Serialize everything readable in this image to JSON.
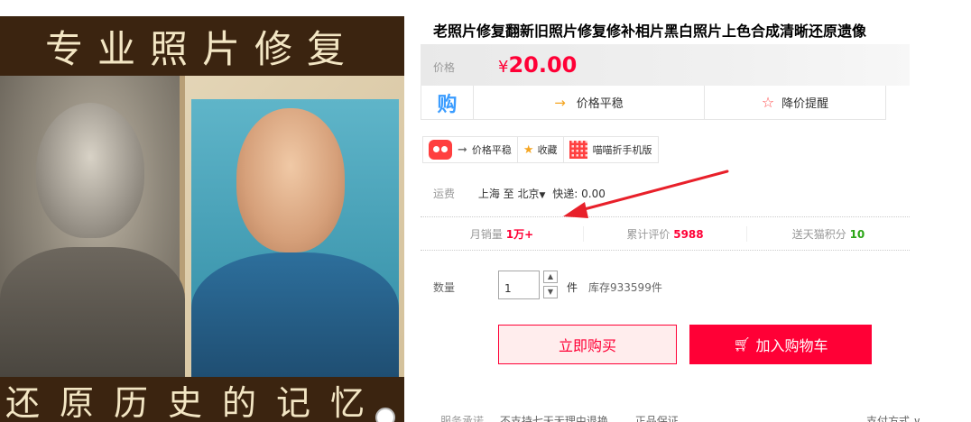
{
  "image": {
    "top_banner": "专业照片修复",
    "bottom_banner": "还原历史的记忆"
  },
  "title": "老照片修复翻新旧照片修复修补相片黑白照片上色合成清晰还原遗像",
  "price": {
    "label": "价格",
    "currency": "¥",
    "value": "20.00"
  },
  "trend": {
    "gou": "购",
    "trend_label": "价格平稳",
    "alert_label": "降价提醒"
  },
  "tools": {
    "trend_label": "价格平稳",
    "favorite_label": "收藏",
    "mobile_label": "喵喵折手机版"
  },
  "shipping": {
    "label": "运费",
    "from": "上海 至",
    "to": "北京",
    "method": "快递: 0.00"
  },
  "stats": {
    "monthly_label": "月销量",
    "monthly_value": "1万+",
    "reviews_label": "累计评价",
    "reviews_value": "5988",
    "points_label": "送天猫积分",
    "points_value": "10"
  },
  "quantity": {
    "label": "数量",
    "value": "1",
    "unit": "件",
    "stock": "库存933599件"
  },
  "buttons": {
    "buy_now": "立即购买",
    "add_to_cart": "加入购物车"
  },
  "service": {
    "label": "服务承诺",
    "item1": "不支持七天无理由退换",
    "item2": "正品保证",
    "payment": "支付方式 ∨"
  },
  "colors": {
    "accent": "#ff0036",
    "banner": "#3b2410",
    "arrow": "#e8202a"
  }
}
